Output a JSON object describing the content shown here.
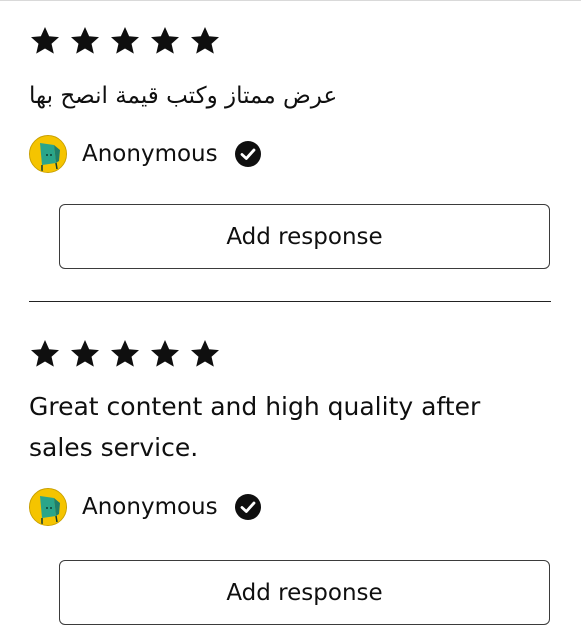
{
  "reviews": [
    {
      "rating": 5,
      "text": "عرض ممتاز وكتب قيمة انصح بها",
      "author": "Anonymous",
      "verified_icon": "verified-check-icon",
      "button_label": "Add response"
    },
    {
      "rating": 5,
      "text": "Great content and high quality after sales service.",
      "author": "Anonymous",
      "verified_icon": "verified-check-icon",
      "button_label": "Add response"
    }
  ],
  "colors": {
    "star": "#0f0f0f",
    "avatar_bg": "#f5c400",
    "avatar_figure": "#2aa58a",
    "button_border": "#3b3b3b",
    "divider": "#222222"
  }
}
